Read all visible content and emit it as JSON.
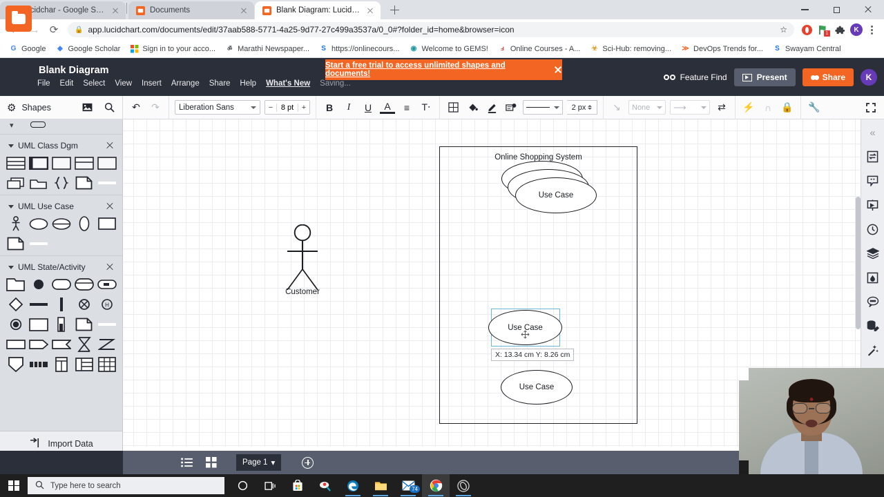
{
  "browser": {
    "tabs": [
      {
        "title": "Lucidchar - Google Search",
        "favicon": "G",
        "active": false
      },
      {
        "title": "Documents",
        "favicon": "L",
        "active": false
      },
      {
        "title": "Blank Diagram: Lucidchart",
        "favicon": "L",
        "active": true
      }
    ],
    "new_tab_label": "+",
    "window_controls": {
      "minimize": "minimize-icon",
      "maximize": "maximize-icon",
      "close": "close-icon"
    },
    "nav": {
      "back": "back-arrow-icon",
      "forward": "forward-arrow-icon",
      "reload": "reload-icon"
    },
    "address": {
      "lock": "lock-icon",
      "url": "app.lucidchart.com/documents/edit/37aab588-5771-4a25-9d77-27c499a3537a/0_0#?folder_id=home&browser=icon",
      "star": "bookmark-star-icon"
    },
    "extensions": [
      "opera-icon",
      "green-extension-icon",
      "puzzle-extension-icon"
    ],
    "extension_badge": "1",
    "profile_initial": "K",
    "bookmarks": [
      {
        "label": "Google",
        "favicon": "G"
      },
      {
        "label": "Google Scholar",
        "favicon": "◆"
      },
      {
        "label": "Sign in to your acco...",
        "favicon": "⊞"
      },
      {
        "label": "Marathi Newspaper...",
        "favicon": "ॐ"
      },
      {
        "label": "https://onlinecours...",
        "favicon": "S"
      },
      {
        "label": "Welcome to GEMS!",
        "favicon": "◉"
      },
      {
        "label": "Online Courses - A...",
        "favicon": "⅄"
      },
      {
        "label": "Sci-Hub: removing...",
        "favicon": "☣"
      },
      {
        "label": "DevOps Trends for...",
        "favicon": "≫"
      },
      {
        "label": "Swayam Central",
        "favicon": "S"
      }
    ]
  },
  "app": {
    "logo": "lucidchart-folder-logo",
    "document_title": "Blank Diagram",
    "menu": [
      "File",
      "Edit",
      "Select",
      "View",
      "Insert",
      "Arrange",
      "Share",
      "Help"
    ],
    "menu_highlight": "What's New",
    "save_status": "Saving...",
    "banner": {
      "text": "Start a free trial to access unlimited shapes and documents!",
      "close": "close-icon"
    },
    "header_actions": {
      "feature_find": "Feature Find",
      "present": "Present",
      "share": "Share",
      "avatar_initial": "K"
    }
  },
  "toolbar": {
    "shapes_label": "Shapes",
    "gear_icon": "gear-icon",
    "image_icon": "image-icon",
    "search_icon": "search-icon",
    "undo_icon": "undo-icon",
    "redo_icon": "redo-icon",
    "font_family": "Liberation Sans",
    "font_size": "8 pt",
    "font_minus": "−",
    "font_plus": "+",
    "bold": "B",
    "italic": "I",
    "underline": "U",
    "text_color": "A",
    "align": "align-icon",
    "text_options": "T",
    "table_icon": "table-icon",
    "fill_icon": "fill-bucket-icon",
    "line_color_icon": "line-color-icon",
    "shape_style_icon": "shape-style-icon",
    "line_style": "solid-line",
    "line_weight": "2 px",
    "line_draw_icon": "line-draw-icon",
    "start_marker": "None",
    "end_marker": "arrow-marker",
    "swap_icon": "swap-direction-icon",
    "lightning_icon": "lightning-icon",
    "magnet_icon": "magnet-icon",
    "lock_icon": "lock-icon",
    "wrench_icon": "wrench-icon",
    "fullscreen_icon": "fullscreen-icon"
  },
  "left_panel": {
    "sections": [
      {
        "title": "UML Class Dgm",
        "close": "close-icon",
        "shapes": [
          "class-3-compartments",
          "class-filled-header",
          "class-simple-box",
          "class-2-compartments",
          "class-empty-box",
          "package-multi",
          "package-folder",
          "curly-braces-note",
          "note-document",
          "divider-line"
        ]
      },
      {
        "title": "UML Use Case",
        "close": "close-icon",
        "shapes": [
          "actor-stick-figure",
          "use-case-ellipse",
          "use-case-divided-ellipse",
          "tall-ellipse",
          "system-boundary-box",
          "note-document",
          "divider-line"
        ]
      },
      {
        "title": "UML State/Activity",
        "close": "close-icon",
        "shapes": [
          "state-frame",
          "initial-state-dot",
          "rounded-state",
          "state-two-parts",
          "state-with-icon",
          "decision-diamond",
          "horizontal-bar",
          "vertical-bar",
          "terminate-x-circle",
          "history-circle",
          "final-state",
          "plain-rect",
          "object-with-bar",
          "note-document",
          "divider-line",
          "flat-rect",
          "send-signal",
          "receive-signal",
          "hourglass-junction",
          "zigzag-connector",
          "shield-shape",
          "pins-shape",
          "partition-vertical",
          "partition-mixed",
          "partition-grid"
        ]
      }
    ],
    "import_data": "Import Data",
    "import_icon": "import-arrow-icon"
  },
  "canvas": {
    "system_boundary_title": "Online Shopping System",
    "use_case_stack_label": "Use Case",
    "selected_use_case_label": "Use Case",
    "bottom_use_case_label": "Use Case",
    "actor_label": "Customer",
    "position_tooltip": "X: 13.34 cm  Y: 8.26 cm",
    "selection_color": "#6bb8d6",
    "move_handle_icon": "move-crosshair-icon"
  },
  "right_rail": {
    "items": [
      {
        "icon": "collapse-chevrons-icon",
        "name": "collapse-panel"
      },
      {
        "icon": "document-swap-icon",
        "name": "document-panel"
      },
      {
        "icon": "quote-comment-icon",
        "name": "notes-panel"
      },
      {
        "icon": "presentation-icon",
        "name": "presentation-panel"
      },
      {
        "icon": "clock-history-icon",
        "name": "revision-history"
      },
      {
        "icon": "layers-icon",
        "name": "layers-panel"
      },
      {
        "icon": "theme-droplet-icon",
        "name": "theme-panel"
      },
      {
        "icon": "chat-bubble-icon",
        "name": "comments-panel"
      },
      {
        "icon": "data-linking-icon",
        "name": "data-panel"
      },
      {
        "icon": "magic-wand-icon",
        "name": "magic-panel"
      }
    ]
  },
  "bottom_bar": {
    "list_view_icon": "list-view-icon",
    "grid_view_icon": "grid-view-icon",
    "page_label": "Page 1",
    "page_caret": "▾",
    "add_page_icon": "add-page-icon",
    "help_icon": "help-circle-icon"
  },
  "taskbar": {
    "start_icon": "windows-start-icon",
    "search_placeholder": "Type here to search",
    "search_icon": "search-icon",
    "apps": [
      {
        "name": "cortana-icon",
        "glyph": "○"
      },
      {
        "name": "task-view-icon",
        "glyph": "⌸"
      },
      {
        "name": "microsoft-store-icon",
        "glyph": "⊞"
      },
      {
        "name": "paint-3d-icon",
        "glyph": "◔"
      },
      {
        "name": "edge-browser-icon",
        "glyph": "e"
      },
      {
        "name": "file-explorer-icon",
        "glyph": "▭"
      },
      {
        "name": "mail-icon",
        "glyph": "✉",
        "badge": "74"
      },
      {
        "name": "chrome-browser-icon",
        "glyph": "●"
      },
      {
        "name": "obs-studio-icon",
        "glyph": "◎"
      }
    ]
  },
  "webcam": {
    "name": "webcam-overlay"
  },
  "colors": {
    "brand_orange": "#f26522",
    "header_dark": "#2b2f3a",
    "panel_gray": "#dbdee3",
    "selection_blue": "#6bb8d6"
  }
}
